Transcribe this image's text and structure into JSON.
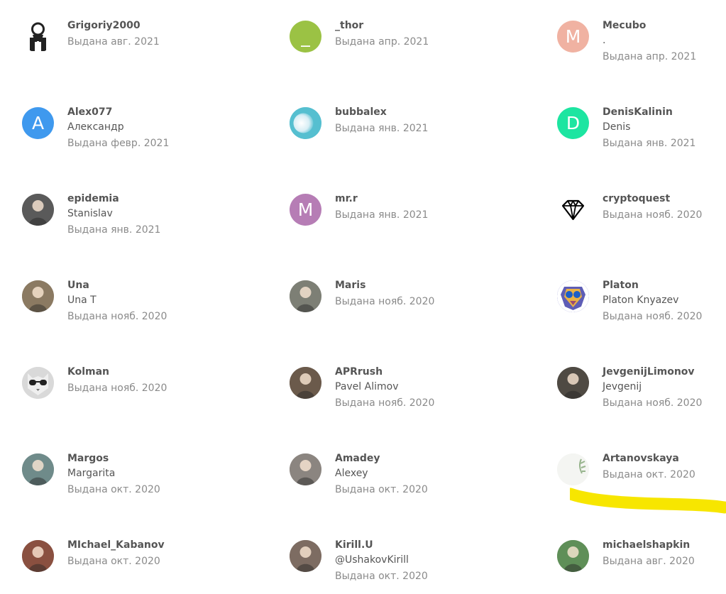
{
  "colors": {
    "username": "#555555",
    "realname": "#555555",
    "issued": "#8a8a8a",
    "highlight": "#f7e600"
  },
  "users": [
    {
      "username": "Grigoriy2000",
      "realname": "",
      "issued": "Выдана авг. 2021",
      "avatar": {
        "type": "icon",
        "icon": "person-tie-icon"
      }
    },
    {
      "username": "_thor",
      "realname": "",
      "issued": "Выдана апр. 2021",
      "avatar": {
        "type": "letter",
        "letter": "_",
        "color": "#9bc244"
      }
    },
    {
      "username": "Mecubo",
      "realname": ".",
      "issued": "Выдана апр. 2021",
      "avatar": {
        "type": "letter",
        "letter": "M",
        "color": "#f0b2a2"
      }
    },
    {
      "username": "Alex077",
      "realname": "Александр",
      "issued": "Выдана февр. 2021",
      "avatar": {
        "type": "letter",
        "letter": "A",
        "color": "#3f99ee"
      }
    },
    {
      "username": "bubbalex",
      "realname": "",
      "issued": "Выдана янв. 2021",
      "avatar": {
        "type": "icon",
        "icon": "gradient-circle-icon"
      }
    },
    {
      "username": "DenisKalinin",
      "realname": "Denis",
      "issued": "Выдана янв. 2021",
      "avatar": {
        "type": "letter",
        "letter": "D",
        "color": "#1de5a1"
      }
    },
    {
      "username": "epidemia",
      "realname": "Stanislav",
      "issued": "Выдана янв. 2021",
      "avatar": {
        "type": "photo",
        "icon": "photo-avatar-icon",
        "color": "#5a5a5a"
      }
    },
    {
      "username": "mr.r",
      "realname": "",
      "issued": "Выдана янв. 2021",
      "avatar": {
        "type": "letter",
        "letter": "M",
        "color": "#b67db5"
      }
    },
    {
      "username": "cryptoquest",
      "realname": "",
      "issued": "Выдана нояб. 2020",
      "avatar": {
        "type": "icon",
        "icon": "diamond-icon"
      }
    },
    {
      "username": "Una",
      "realname": "Una T",
      "issued": "Выдана нояб. 2020",
      "avatar": {
        "type": "photo",
        "icon": "photo-avatar-icon",
        "color": "#8b7a62"
      }
    },
    {
      "username": "Maris",
      "realname": "",
      "issued": "Выдана нояб. 2020",
      "avatar": {
        "type": "photo",
        "icon": "photo-avatar-icon",
        "color": "#7d7f75"
      }
    },
    {
      "username": "Platon",
      "realname": "Platon Knyazev",
      "issued": "Выдана нояб. 2020",
      "avatar": {
        "type": "photo",
        "icon": "lion-art-icon",
        "color": "#6a6cc5"
      }
    },
    {
      "username": "Kolman",
      "realname": "",
      "issued": "Выдана нояб. 2020",
      "avatar": {
        "type": "photo",
        "icon": "cat-sunglasses-icon",
        "color": "#d8d8d8"
      }
    },
    {
      "username": "APRrush",
      "realname": "Pavel Alimov",
      "issued": "Выдана нояб. 2020",
      "avatar": {
        "type": "photo",
        "icon": "photo-avatar-icon",
        "color": "#6b5a4b"
      }
    },
    {
      "username": "JevgenijLimonov",
      "realname": "Jevgenij",
      "issued": "Выдана нояб. 2020",
      "avatar": {
        "type": "photo",
        "icon": "photo-avatar-icon",
        "color": "#4f4a43"
      }
    },
    {
      "username": "Margos",
      "realname": "Margarita",
      "issued": "Выдана окт. 2020",
      "avatar": {
        "type": "photo",
        "icon": "photo-avatar-icon",
        "color": "#6f8b8a"
      }
    },
    {
      "username": "Amadey",
      "realname": "Alexey",
      "issued": "Выдана окт. 2020",
      "avatar": {
        "type": "photo",
        "icon": "photo-avatar-icon",
        "color": "#8b8580"
      }
    },
    {
      "username": "Artanovskaya",
      "realname": "",
      "issued": "Выдана окт. 2020",
      "avatar": {
        "type": "photo",
        "icon": "plant-avatar-icon",
        "color": "#f2f4f1"
      }
    },
    {
      "username": "MIchael_Kabanov",
      "realname": "",
      "issued": "Выдана окт. 2020",
      "avatar": {
        "type": "photo",
        "icon": "photo-avatar-icon",
        "color": "#8a5040"
      }
    },
    {
      "username": "Kirill.U",
      "realname": "@UshakovKirill",
      "issued": "Выдана окт. 2020",
      "avatar": {
        "type": "photo",
        "icon": "photo-avatar-icon",
        "color": "#7d6c62"
      }
    },
    {
      "username": "michaelshapkin",
      "realname": "",
      "issued": "Выдана авг. 2020",
      "avatar": {
        "type": "photo",
        "icon": "photo-avatar-icon",
        "color": "#5f8f58"
      }
    }
  ]
}
